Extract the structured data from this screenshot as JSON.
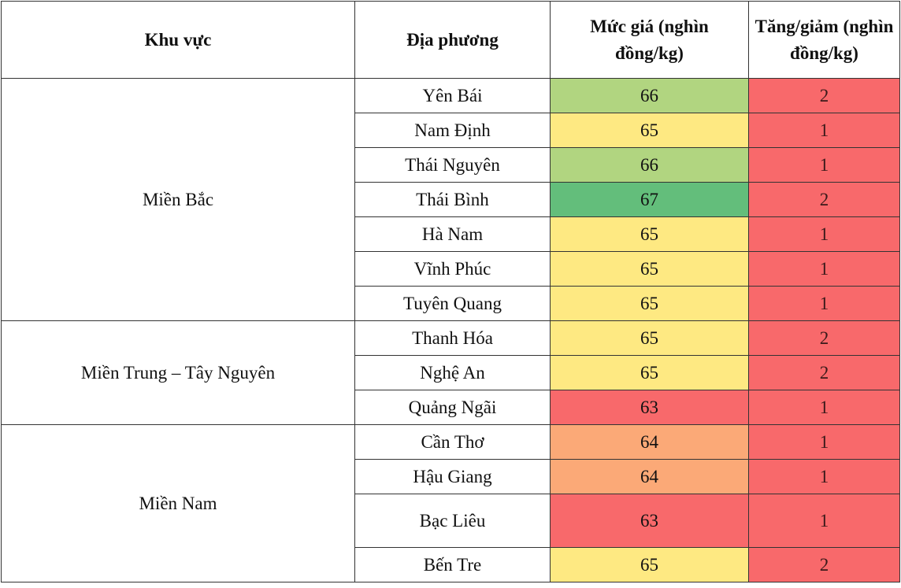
{
  "table": {
    "headers": {
      "region": "Khu vực",
      "place": "Địa phương",
      "price": "Mức giá (nghìn đồng/kg)",
      "change": "Tăng/giảm (nghìn đồng/kg)"
    },
    "regions": [
      {
        "name": "Miền Bắc",
        "rows": [
          {
            "place": "Yên Bái",
            "price": "66",
            "change": "2",
            "price_color": "#b1d580"
          },
          {
            "place": "Nam Định",
            "price": "65",
            "change": "1",
            "price_color": "#fee982"
          },
          {
            "place": "Thái Nguyên",
            "price": "66",
            "change": "1",
            "price_color": "#b1d580"
          },
          {
            "place": "Thái Bình",
            "price": "67",
            "change": "2",
            "price_color": "#63be7b"
          },
          {
            "place": "Hà Nam",
            "price": "65",
            "change": "1",
            "price_color": "#fee982"
          },
          {
            "place": "Vĩnh Phúc",
            "price": "65",
            "change": "1",
            "price_color": "#fee982"
          },
          {
            "place": "Tuyên Quang",
            "price": "65",
            "change": "1",
            "price_color": "#fee982"
          }
        ]
      },
      {
        "name": "Miền Trung – Tây Nguyên",
        "rows": [
          {
            "place": "Thanh Hóa",
            "price": "65",
            "change": "2",
            "price_color": "#fee982"
          },
          {
            "place": "Nghệ An",
            "price": "65",
            "change": "2",
            "price_color": "#fee982"
          },
          {
            "place": "Quảng Ngãi",
            "price": "63",
            "change": "1",
            "price_color": "#f8696b"
          }
        ]
      },
      {
        "name": "Miền Nam",
        "rows": [
          {
            "place": "Cần Thơ",
            "price": "64",
            "change": "1",
            "price_color": "#fba977"
          },
          {
            "place": "Hậu Giang",
            "price": "64",
            "change": "1",
            "price_color": "#fba977"
          },
          {
            "place": "Bạc Liêu",
            "price": "63",
            "change": "1",
            "price_color": "#f8696b"
          },
          {
            "place": "Bến Tre",
            "price": "65",
            "change": "2",
            "price_color": "#fee982"
          }
        ]
      }
    ],
    "change_color": "#f8696b"
  }
}
